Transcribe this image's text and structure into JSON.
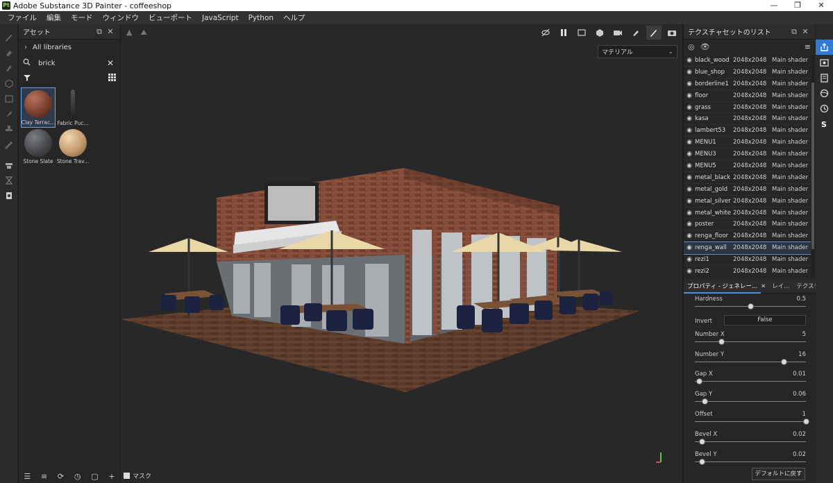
{
  "window": {
    "title": "Adobe Substance 3D Painter - coffeeshop",
    "app_icon": "Pt",
    "controls": {
      "minimize": "—",
      "maximize": "❐",
      "close": "✕"
    }
  },
  "menu": [
    "ファイル",
    "編集",
    "モード",
    "ウィンドウ",
    "ビューポート",
    "JavaScript",
    "Python",
    "ヘルプ"
  ],
  "assets": {
    "title": "アセット",
    "library": "All libraries",
    "search_value": "brick",
    "items": [
      {
        "label": "Clay Terrac...",
        "color": "#8a4a3a"
      },
      {
        "label": "Fabric Puc...",
        "color": "#2a2a2a"
      },
      {
        "label": "Stone Slate",
        "color": "#4a4c50"
      },
      {
        "label": "Stone Trav...",
        "color": "#c9a57a"
      }
    ]
  },
  "viewport": {
    "material_select": "マテリアル",
    "mask_label": "マスク"
  },
  "texture_sets": {
    "title": "テクスチャセットのリスト",
    "rows": [
      {
        "name": "black_wood",
        "res": "2048x2048",
        "shader": "Main shader"
      },
      {
        "name": "blue_shop",
        "res": "2048x2048",
        "shader": "Main shader"
      },
      {
        "name": "borderline1",
        "res": "2048x2048",
        "shader": "Main shader"
      },
      {
        "name": "floor",
        "res": "2048x2048",
        "shader": "Main shader"
      },
      {
        "name": "grass",
        "res": "2048x2048",
        "shader": "Main shader"
      },
      {
        "name": "kasa",
        "res": "2048x2048",
        "shader": "Main shader"
      },
      {
        "name": "lambert53",
        "res": "2048x2048",
        "shader": "Main shader"
      },
      {
        "name": "MENU1",
        "res": "2048x2048",
        "shader": "Main shader"
      },
      {
        "name": "MENU3",
        "res": "2048x2048",
        "shader": "Main shader"
      },
      {
        "name": "MENU5",
        "res": "2048x2048",
        "shader": "Main shader"
      },
      {
        "name": "metal_black",
        "res": "2048x2048",
        "shader": "Main shader"
      },
      {
        "name": "metal_gold",
        "res": "2048x2048",
        "shader": "Main shader"
      },
      {
        "name": "metal_silver",
        "res": "2048x2048",
        "shader": "Main shader"
      },
      {
        "name": "metal_white",
        "res": "2048x2048",
        "shader": "Main shader"
      },
      {
        "name": "poster",
        "res": "2048x2048",
        "shader": "Main shader"
      },
      {
        "name": "renga_floor",
        "res": "2048x2048",
        "shader": "Main shader"
      },
      {
        "name": "renga_wall",
        "res": "2048x2048",
        "shader": "Main shader",
        "selected": true
      },
      {
        "name": "rezi1",
        "res": "2048x2048",
        "shader": "Main shader"
      },
      {
        "name": "rezi2",
        "res": "2048x2048",
        "shader": "Main shader"
      }
    ]
  },
  "tabs": [
    "プロパティ - ジェネレー...",
    "レイ...",
    "テクスチャセットの..."
  ],
  "properties": {
    "hardness": {
      "label": "Hardness",
      "value": "0.5",
      "fraction": 0.5
    },
    "invert": {
      "label": "Invert",
      "value": "False"
    },
    "sliders": [
      {
        "label": "Number X",
        "value": "5",
        "fraction": 0.24
      },
      {
        "label": "Number Y",
        "value": "16",
        "fraction": 0.8
      },
      {
        "label": "Gap X",
        "value": "0.01",
        "fraction": 0.04
      },
      {
        "label": "Gap Y",
        "value": "0.06",
        "fraction": 0.09
      },
      {
        "label": "Offset",
        "value": "1",
        "fraction": 1.0
      },
      {
        "label": "Bevel X",
        "value": "0.02",
        "fraction": 0.06
      },
      {
        "label": "Bevel Y",
        "value": "0.02",
        "fraction": 0.06
      }
    ],
    "reset_label": "デフォルトに戻す"
  },
  "colors": {
    "accent": "#2f7bd6",
    "brick": "#7a3f2c",
    "umbrella": "#e8d8a8"
  }
}
